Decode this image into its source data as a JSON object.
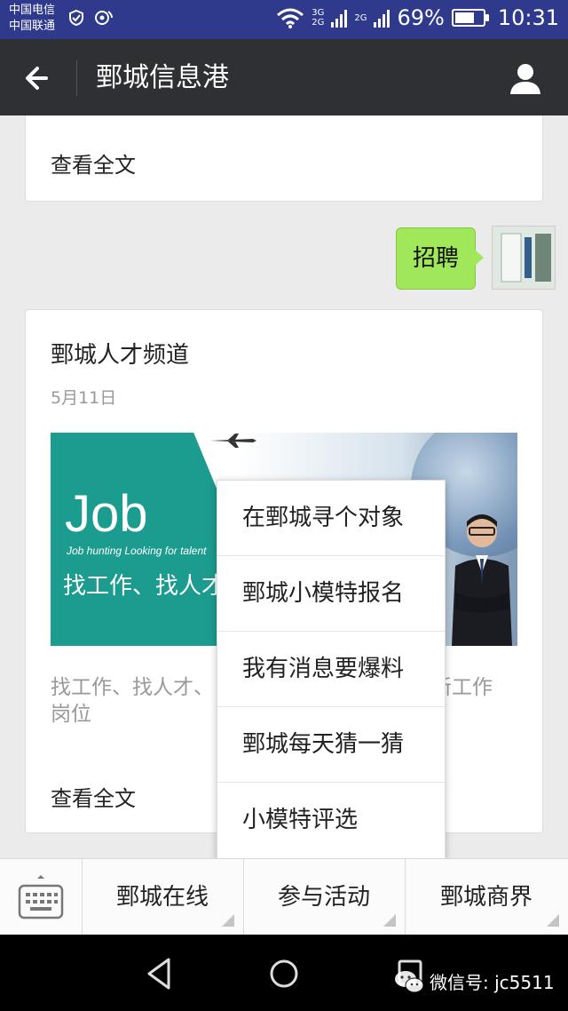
{
  "status_bar": {
    "carrier_1": "中国电信",
    "carrier_2": "中国联通",
    "net_1": "3G",
    "net_1b": "2G",
    "net_2": "2G",
    "battery": "69%",
    "battery_level": 0.69,
    "time": "10:31"
  },
  "header": {
    "title": "鄄城信息港"
  },
  "chat": {
    "top_card_read_all": "查看全文",
    "sent_message": "招聘",
    "article": {
      "title": "鄄城人才频道",
      "date": "5月11日",
      "banner_big": "Job",
      "banner_tagline": "Job hunting Looking for talent",
      "banner_cn": "找工作、找人才",
      "summary": "找工作、找人才、新工作岗位",
      "summary_visible_left": "找工作、找人才、",
      "summary_visible_right": "最新工作",
      "summary_line2": "岗位",
      "read_all": "查看全文"
    }
  },
  "popup_menu": {
    "items": [
      {
        "label": "在鄄城寻个对象"
      },
      {
        "label": "鄄城小模特报名"
      },
      {
        "label": "我有消息要爆料"
      },
      {
        "label": "鄄城每天猜一猜"
      },
      {
        "label": "小模特评选"
      }
    ]
  },
  "menu_bar": {
    "buttons": [
      {
        "label": "鄄城在线"
      },
      {
        "label": "参与活动"
      },
      {
        "label": "鄄城商界"
      }
    ]
  },
  "watermark": {
    "text": "微信号: jc5511"
  },
  "colors": {
    "status_bar": "#2f3a8c",
    "title_bar": "#2f3033",
    "bubble": "#a0e75a",
    "banner_teal": "#1c9b8f"
  }
}
